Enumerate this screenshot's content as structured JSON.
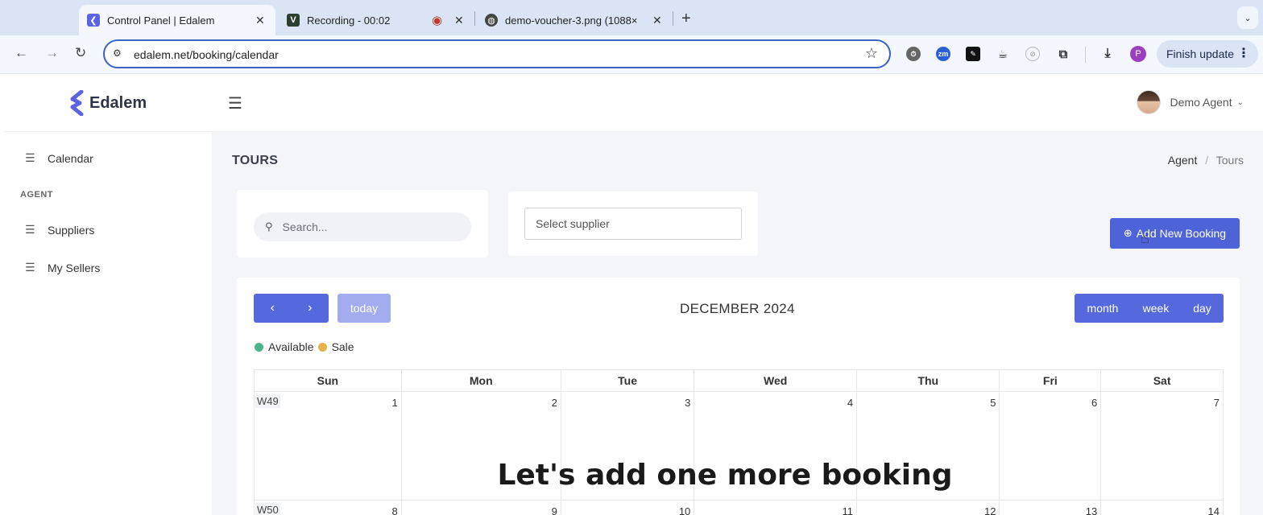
{
  "browser": {
    "tabs": [
      {
        "title": "Control Panel | Edalem",
        "favicon_color": "#5b63e0"
      },
      {
        "title": "Recording - 00:02",
        "favicon_color": "#2c3e2e"
      },
      {
        "title": "demo-voucher-3.png (1088×",
        "favicon_color": "#444444"
      }
    ],
    "url": "edalem.net/booking/calendar",
    "profile_initial": "P",
    "finish_update": "Finish update"
  },
  "app": {
    "logo_text": "Edalem",
    "user_name": "Demo Agent",
    "brand_color": "#4e63d8"
  },
  "sidebar": {
    "calendar_label": "Calendar",
    "section_heading": "AGENT",
    "items": [
      {
        "label": "Suppliers"
      },
      {
        "label": "My Sellers"
      }
    ]
  },
  "page": {
    "title": "TOURS",
    "breadcrumb": [
      "Agent",
      "Tours"
    ],
    "search_placeholder": "Search...",
    "supplier_placeholder": "Select supplier",
    "add_button": "Add New Booking"
  },
  "calendar": {
    "title": "DECEMBER 2024",
    "today_label": "today",
    "views": [
      "month",
      "week",
      "day"
    ],
    "legend": [
      {
        "label": "Available",
        "color": "#4cb38a"
      },
      {
        "label": "Sale",
        "color": "#e6b24a"
      }
    ],
    "weekdays": [
      "Sun",
      "Mon",
      "Tue",
      "Wed",
      "Thu",
      "Fri",
      "Sat"
    ],
    "weeks": [
      {
        "label": "W49",
        "days": [
          "1",
          "2",
          "3",
          "4",
          "5",
          "6",
          "7"
        ]
      },
      {
        "label": "W50",
        "days": [
          "8",
          "9",
          "10",
          "11",
          "12",
          "13",
          "14"
        ]
      }
    ]
  },
  "caption": "Let's add one more booking"
}
